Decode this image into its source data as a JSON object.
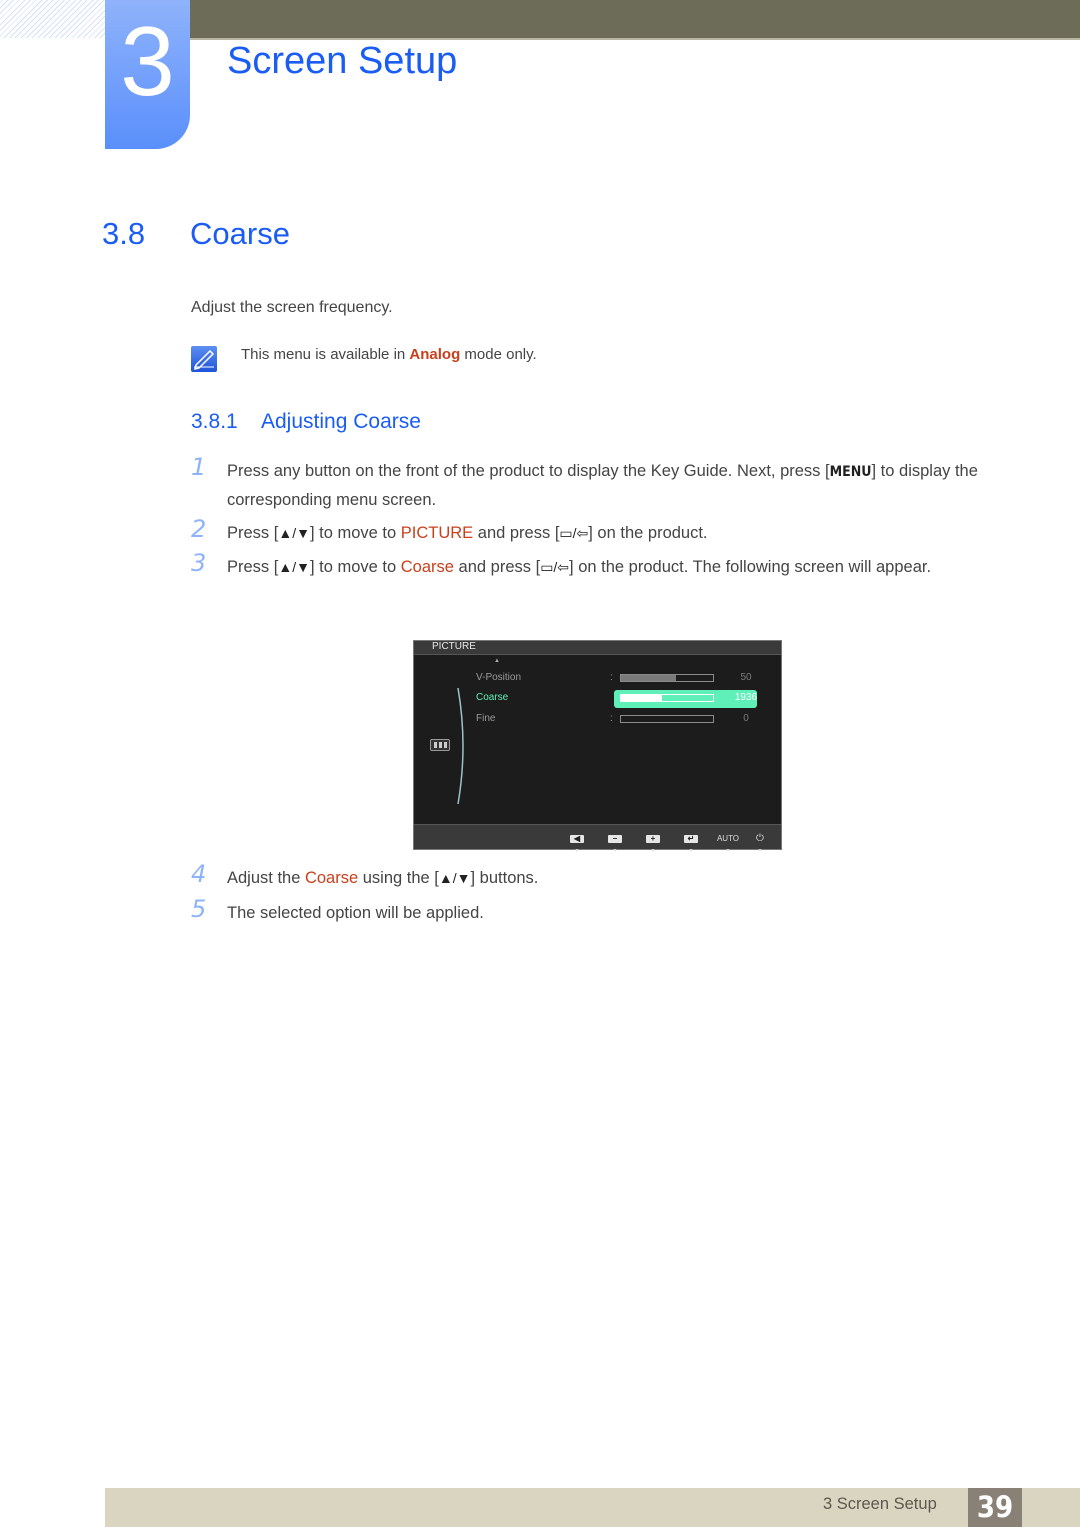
{
  "chapter": {
    "number": "3",
    "title": "Screen Setup"
  },
  "section": {
    "number": "3.8",
    "title": "Coarse",
    "intro": "Adjust the screen frequency.",
    "note": {
      "icon": "note-pencil-icon",
      "before": "This menu is available in ",
      "highlight": "Analog",
      "after": " mode only."
    }
  },
  "subsection": {
    "number": "3.8.1",
    "title": "Adjusting Coarse"
  },
  "steps": [
    {
      "n": "1",
      "parts": [
        "Press any button on the front of the product to display the Key Guide. Next, press [",
        "MENU",
        "] to display the corresponding menu screen."
      ]
    },
    {
      "n": "2",
      "parts": [
        "Press [",
        "▲/▼",
        "] to move to ",
        "PICTURE",
        " and press [",
        "▭/⇦",
        "] on the product."
      ]
    },
    {
      "n": "3",
      "parts": [
        "Press [",
        "▲/▼",
        "] to move to ",
        "Coarse",
        " and press [",
        "▭/⇦",
        "] on the product. The following screen will appear."
      ]
    },
    {
      "n": "4",
      "parts": [
        "Adjust the ",
        "Coarse",
        " using the [",
        "▲/▼",
        "] buttons."
      ]
    },
    {
      "n": "5",
      "parts": [
        "The selected option will be applied."
      ]
    }
  ],
  "osd": {
    "title": "PICTURE",
    "up_arrow": "▲",
    "rows": [
      {
        "label": "V-Position",
        "colon": ":",
        "value": "50",
        "fill_fraction": 0.6,
        "selected": false
      },
      {
        "label": "Coarse",
        "colon": ":",
        "value": "1936",
        "fill_fraction": 0.45,
        "selected": true
      },
      {
        "label": "Fine",
        "colon": ":",
        "value": "0",
        "fill_fraction": 0.0,
        "selected": false
      }
    ],
    "category_icon": "picture-menu-icon",
    "footer_buttons": [
      {
        "name": "left-arrow-button",
        "glyph": "◀",
        "arrow": "▼"
      },
      {
        "name": "minus-button",
        "glyph": "−",
        "arrow": "▼"
      },
      {
        "name": "plus-button",
        "glyph": "+",
        "arrow": "▼"
      },
      {
        "name": "enter-button",
        "glyph": "↵",
        "arrow": "▼"
      },
      {
        "name": "auto-button",
        "glyph": "AUTO",
        "arrow": "▼"
      },
      {
        "name": "power-button",
        "glyph": "⏻",
        "arrow": "▼"
      }
    ],
    "colors": {
      "selected": "#5ef0b8",
      "background": "#1c1c1c"
    }
  },
  "footer": {
    "label": "3 Screen Setup",
    "page": "39"
  },
  "colors": {
    "heading": "#1a5cf4",
    "highlight": "#c8401c",
    "step_number": "#8fb3fb",
    "top_bar": "#6d6c58",
    "footer_bg": "#dad5c0",
    "page_badge": "#8a8176"
  }
}
